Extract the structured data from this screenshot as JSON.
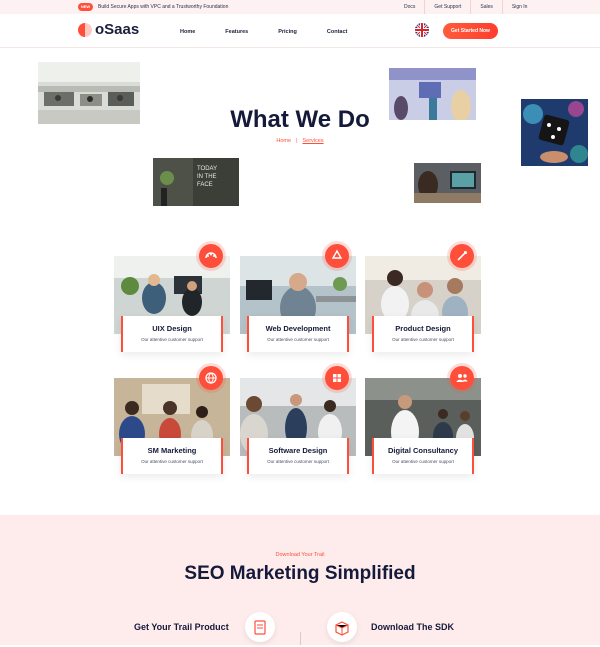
{
  "topbar": {
    "badge": "NEW",
    "announcement": "Build Secure Apps with VPC and a Trustworthy Foundation",
    "links": [
      "Docs",
      "Get Support",
      "Sales",
      "Sign In"
    ]
  },
  "header": {
    "logo": "oSaas",
    "nav": [
      "Home",
      "Features",
      "Pricing",
      "Contact"
    ],
    "cta": "Get Started Now"
  },
  "hero": {
    "title": "What We Do",
    "breadcrumb_home": "Home",
    "breadcrumb_sep": "|",
    "breadcrumb_current": "Services"
  },
  "services": [
    {
      "title": "UIX Design",
      "subtitle": "Our attentive customer support",
      "icon": "palette-icon"
    },
    {
      "title": "Web Development",
      "subtitle": "Our attentive customer support",
      "icon": "recycle-icon"
    },
    {
      "title": "Product Design",
      "subtitle": "Our attentive customer support",
      "icon": "pen-icon"
    },
    {
      "title": "SM Marketing",
      "subtitle": "Our attentive customer support",
      "icon": "globe-icon"
    },
    {
      "title": "Software Design",
      "subtitle": "Our attentive customer support",
      "icon": "grid-icon"
    },
    {
      "title": "Digital Consultancy",
      "subtitle": "Our attentive customer support",
      "icon": "users-icon"
    }
  ],
  "seo": {
    "eyebrow": "Download Your Trail",
    "title": "SEO Marketing Simplified",
    "left": "Get Your Trail Product",
    "right": "Download The SDK"
  },
  "colors": {
    "accent": "#ff4e3a",
    "dark": "#161a3a",
    "pink_bg": "#fdeceb"
  }
}
